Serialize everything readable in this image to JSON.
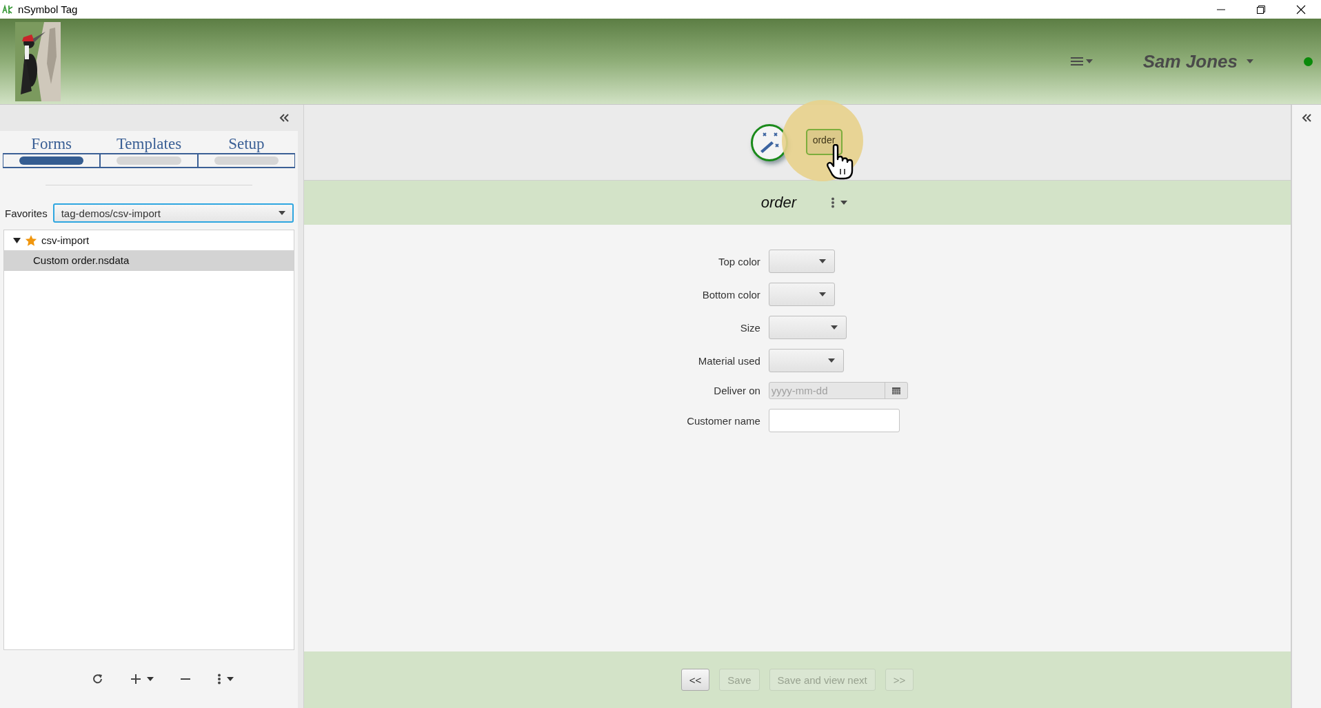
{
  "window": {
    "title": "nSymbol Tag"
  },
  "header": {
    "user_name": "Sam Jones"
  },
  "left_panel": {
    "tabs": [
      {
        "label": "Forms",
        "selected": true
      },
      {
        "label": "Templates",
        "selected": false
      },
      {
        "label": "Setup",
        "selected": false
      }
    ],
    "favorites": {
      "label": "Favorites",
      "value": "tag-demos/csv-import"
    },
    "tree": [
      {
        "label": "csv-import",
        "starred": true,
        "expanded": true,
        "children": [
          {
            "label": "Custom order.nsdata",
            "selected": true
          }
        ]
      }
    ]
  },
  "main": {
    "toolbar": {
      "button_label": "order"
    },
    "form_title": "order",
    "fields": [
      {
        "kind": "dropdown",
        "label": "Top color"
      },
      {
        "kind": "dropdown",
        "label": "Bottom color"
      },
      {
        "kind": "dropdown",
        "label": "Size"
      },
      {
        "kind": "dropdown",
        "label": "Material used"
      },
      {
        "kind": "date",
        "label": "Deliver on",
        "placeholder": "yyyy-mm-dd"
      },
      {
        "kind": "text",
        "label": "Customer name"
      }
    ],
    "nav_buttons": [
      {
        "label": "<<",
        "disabled": false
      },
      {
        "label": "Save",
        "disabled": true
      },
      {
        "label": "Save and view next",
        "disabled": true
      },
      {
        "label": ">>",
        "disabled": true
      }
    ]
  }
}
